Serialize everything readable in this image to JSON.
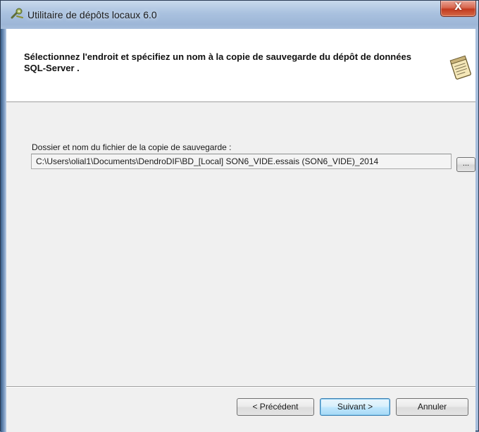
{
  "window": {
    "title": "Utilitaire de dépôts locaux 6.0",
    "close_glyph": "X"
  },
  "header": {
    "instruction": "Sélectionnez l'endroit et spécifiez un nom à la copie de sauvegarde du dépôt de données SQL-Server .",
    "icon": "notepad-icon"
  },
  "form": {
    "label": "Dossier et nom du fichier de la copie de sauvegarde :",
    "path_value": "C:\\Users\\olial1\\Documents\\DendroDIF\\BD_[Local] SON6_VIDE.essais (SON6_VIDE)_2014",
    "browse_label": "..."
  },
  "footer": {
    "previous_label": "< Précédent",
    "next_label": "Suivant >",
    "cancel_label": "Annuler"
  },
  "colors": {
    "accent": "#3c7fb1",
    "close": "#c23a1f"
  }
}
